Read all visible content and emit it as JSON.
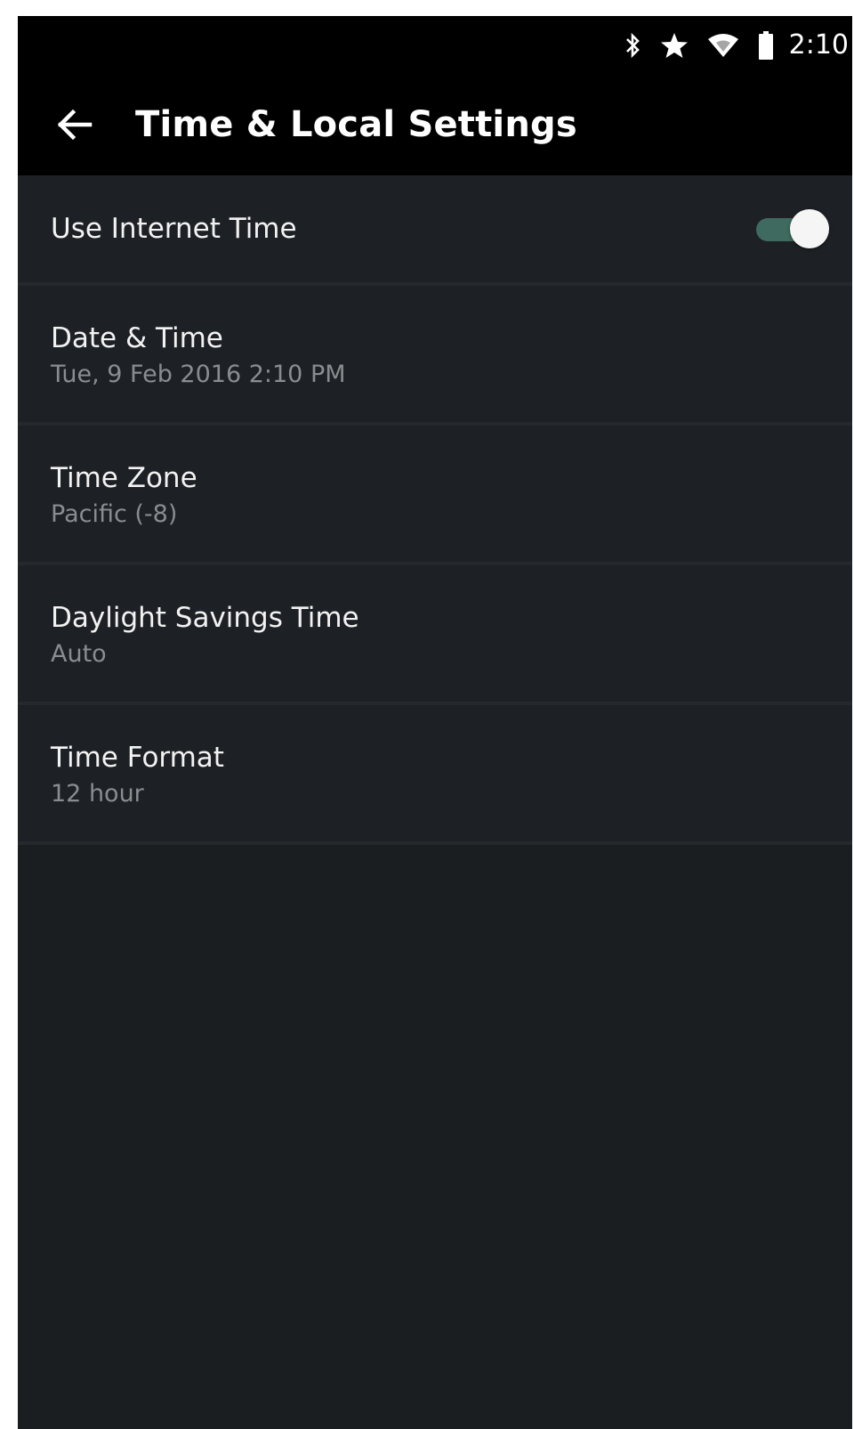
{
  "status_bar": {
    "icons": [
      "bluetooth-icon",
      "star-icon",
      "wifi-icon",
      "battery-icon"
    ],
    "time": "2:10"
  },
  "app_bar": {
    "back_icon": "arrow-left-icon",
    "title": "Time & Local Settings"
  },
  "settings": {
    "use_internet_time": {
      "label": "Use Internet Time",
      "enabled": true
    },
    "date_time": {
      "title": "Date & Time",
      "value": "Tue,  9 Feb 2016  2:10 PM"
    },
    "time_zone": {
      "title": "Time Zone",
      "value": "Pacific (-8)"
    },
    "daylight_savings": {
      "title": "Daylight Savings Time",
      "value": "Auto"
    },
    "time_format": {
      "title": "Time Format",
      "value": "12 hour"
    }
  },
  "colors": {
    "background": "#1b1e21",
    "bars": "#000000",
    "primary_text": "#f2f2f2",
    "secondary_text": "#8a8d90",
    "toggle_track_on": "#3e6a5f",
    "toggle_thumb": "#f5f5f5"
  }
}
